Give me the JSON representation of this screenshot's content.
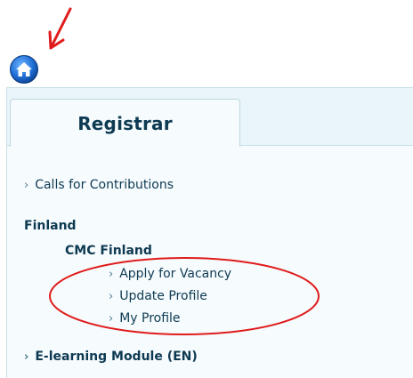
{
  "tab": {
    "label": "Registrar"
  },
  "menu": {
    "calls": "Calls for Contributions",
    "country": "Finland",
    "organization": "CMC Finland",
    "sub_items": [
      "Apply for Vacancy",
      "Update Profile",
      "My Profile"
    ],
    "elearning": "E-learning Module (EN)"
  },
  "colors": {
    "annotation": "#e01b1b",
    "heading_text": "#0d3a52",
    "home_icon": "#1f6fd6"
  },
  "icons": {
    "chevron": "›",
    "home": "home-icon"
  }
}
